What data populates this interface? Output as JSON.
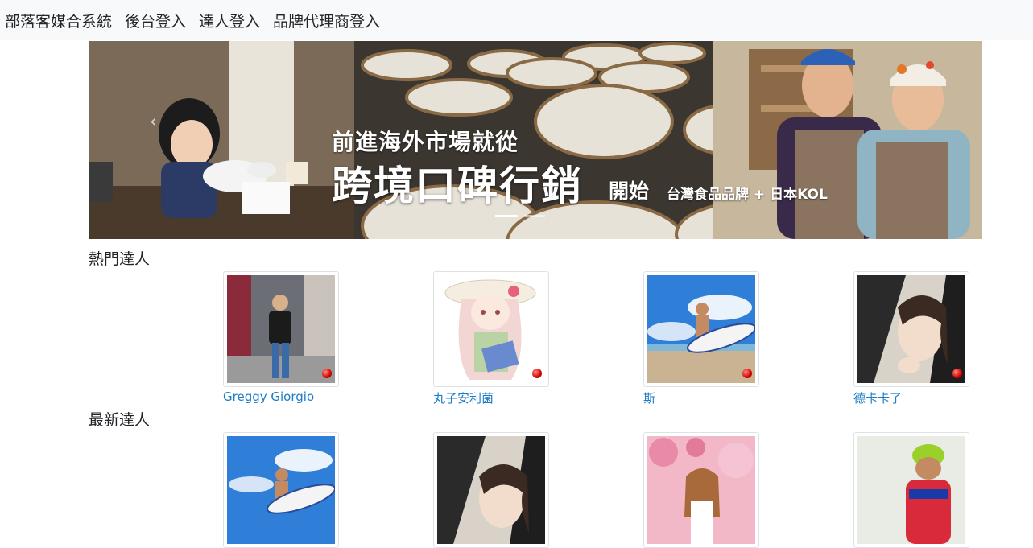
{
  "navbar": {
    "brand": "部落客媒合系統",
    "links": [
      "後台登入",
      "達人登入",
      "品牌代理商登入"
    ]
  },
  "banner": {
    "line1": "前進海外市場就從",
    "line2": "跨境口碑行銷",
    "line3": "開始",
    "line4": "台灣食品品牌 + 日本KOL",
    "prev_icon": "chevron-left-icon"
  },
  "sections": {
    "popular": {
      "title": "熱門達人",
      "items": [
        {
          "name": "Greggy Giorgio"
        },
        {
          "name": "丸子安利菌"
        },
        {
          "name": "斯"
        },
        {
          "name": "德卡卡了"
        }
      ]
    },
    "newest": {
      "title": "最新達人"
    }
  },
  "colors": {
    "navbar_bg": "#f8f9fa",
    "link": "#1c7cc6",
    "badge": "#d50000"
  }
}
